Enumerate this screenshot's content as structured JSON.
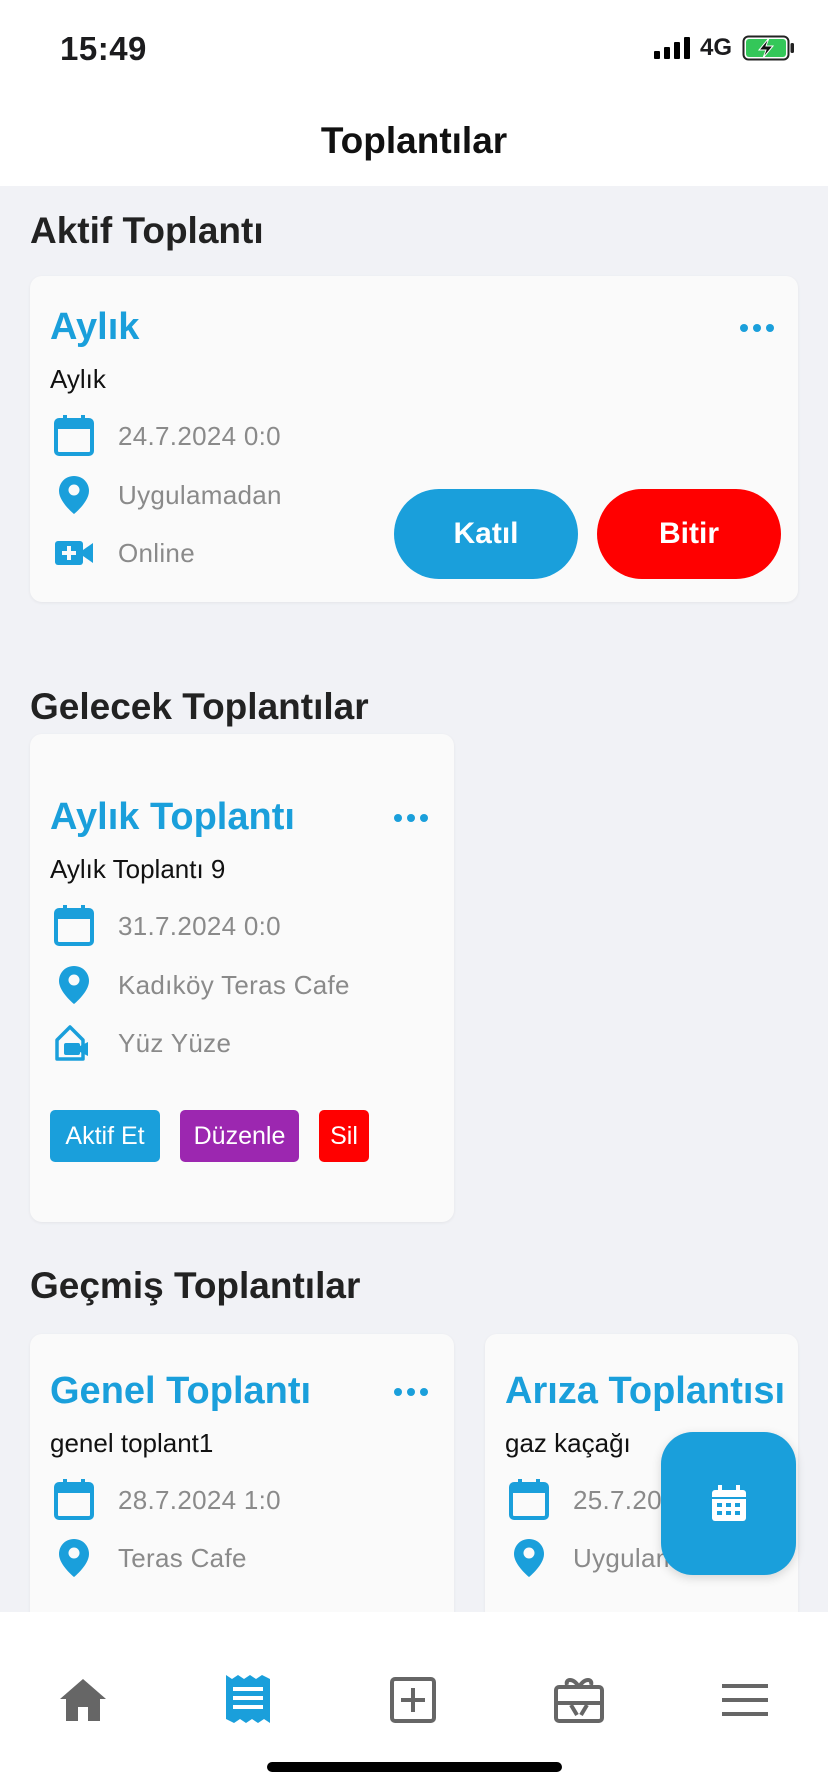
{
  "status": {
    "time": "15:49",
    "network": "4G"
  },
  "header": {
    "title": "Toplantılar"
  },
  "active": {
    "section_title": "Aktif Toplantı",
    "card": {
      "title": "Aylık",
      "subtitle": "Aylık",
      "date": "24.7.2024 0:0",
      "location": "Uygulamadan",
      "mode": "Online",
      "join_label": "Katıl",
      "end_label": "Bitir"
    }
  },
  "upcoming": {
    "section_title": "Gelecek Toplantılar",
    "cards": [
      {
        "title": "Aylık Toplantı",
        "subtitle": "Aylık Toplantı 9",
        "date": "31.7.2024 0:0",
        "location": "Kadıköy Teras Cafe",
        "mode": "Yüz Yüze",
        "activate_label": "Aktif Et",
        "edit_label": "Düzenle",
        "delete_label": "Sil"
      }
    ]
  },
  "past": {
    "section_title": "Geçmiş Toplantılar",
    "cards": [
      {
        "title": "Genel Toplantı",
        "subtitle": "genel toplant1",
        "date": "28.7.2024 1:0",
        "location": "Teras Cafe"
      },
      {
        "title": "Arıza Toplantısı",
        "subtitle": "gaz kaçağı",
        "date": "25.7.20",
        "location": "Uygulam"
      }
    ]
  },
  "fab": {
    "icon": "calendar-icon"
  },
  "tabbar": {
    "items": [
      "home-icon",
      "receipt-icon",
      "add-box-icon",
      "gift-card-icon",
      "menu-icon"
    ],
    "active_index": 1
  },
  "colors": {
    "accent": "#1a9fdb",
    "danger": "#ff0000",
    "purple": "#9c27b0",
    "background": "#f1f2f6"
  }
}
